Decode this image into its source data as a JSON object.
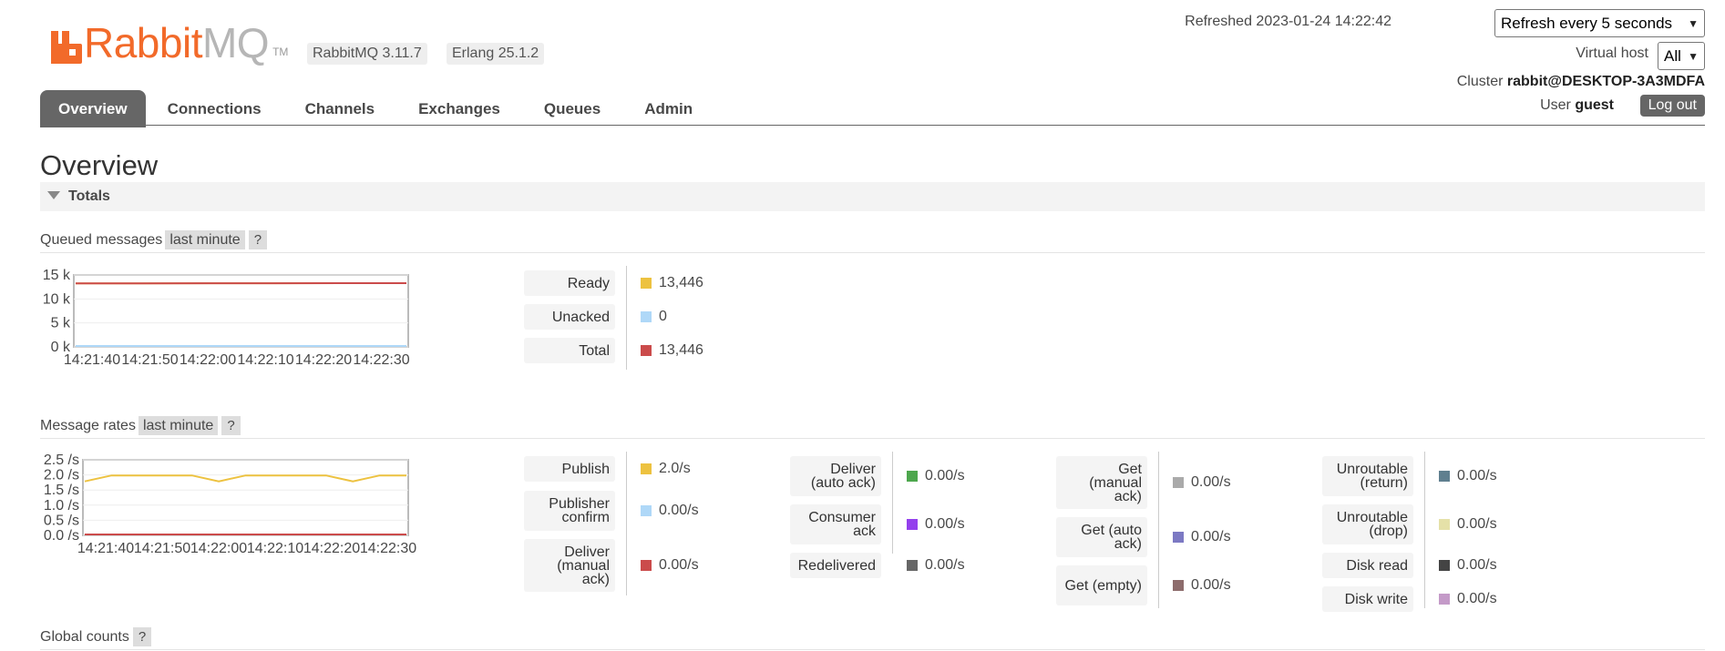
{
  "header": {
    "logo_text": "Rabbit",
    "logo_mq": "MQ",
    "logo_tm": "TM",
    "rabbitmq_version": "RabbitMQ 3.11.7",
    "erlang_version": "Erlang 25.1.2",
    "refreshed_label": "Refreshed 2023-01-24 14:22:42",
    "refresh_select": "Refresh every 5 seconds",
    "vhost_label": "Virtual host",
    "vhost_select": "All",
    "cluster_label": "Cluster",
    "cluster_name": "rabbit@DESKTOP-3A3MDFA",
    "user_label": "User",
    "user_name": "guest",
    "logout": "Log out",
    "logo_color": "#f26a2a"
  },
  "nav": {
    "tabs": [
      "Overview",
      "Connections",
      "Channels",
      "Exchanges",
      "Queues",
      "Admin"
    ],
    "active": "Overview"
  },
  "page": {
    "title": "Overview",
    "totals_section": "Totals",
    "queued_label": "Queued messages",
    "rates_label": "Message rates",
    "range_badge": "last minute",
    "help": "?",
    "global_counts": "Global counts"
  },
  "chart_data": [
    {
      "type": "line",
      "title": "Queued messages",
      "x": [
        "14:21:40",
        "14:21:50",
        "14:22:00",
        "14:22:10",
        "14:22:20",
        "14:22:30"
      ],
      "ytick_labels": [
        "15 k",
        "10 k",
        "5 k",
        "0 k"
      ],
      "ylim": [
        0,
        15000
      ],
      "series": [
        {
          "name": "Ready",
          "color": "#edc240",
          "values": [
            13380,
            13400,
            13420,
            13430,
            13440,
            13446
          ]
        },
        {
          "name": "Unacked",
          "color": "#afd8f8",
          "values": [
            0,
            0,
            0,
            0,
            0,
            0
          ]
        },
        {
          "name": "Total",
          "color": "#cb4b4b",
          "values": [
            13380,
            13400,
            13420,
            13430,
            13440,
            13446
          ]
        }
      ]
    },
    {
      "type": "line",
      "title": "Message rates",
      "x": [
        "14:21:40",
        "14:21:50",
        "14:22:00",
        "14:22:10",
        "14:22:20",
        "14:22:30"
      ],
      "ytick_labels": [
        "2.5 /s",
        "2.0 /s",
        "1.5 /s",
        "1.0 /s",
        "0.5 /s",
        "0.0 /s"
      ],
      "ylim": [
        0,
        2.5
      ],
      "series": [
        {
          "name": "Publish",
          "color": "#edc240",
          "values": [
            1.8,
            2.0,
            2.0,
            2.0,
            2.0,
            1.8,
            2.0,
            2.0,
            2.0,
            2.0,
            1.8,
            2.0,
            2.0
          ]
        },
        {
          "name": "Deliver (manual ack)",
          "color": "#cb4b4b",
          "values": [
            0,
            0,
            0,
            0,
            0,
            0,
            0,
            0,
            0,
            0,
            0,
            0,
            0
          ]
        }
      ]
    }
  ],
  "queued_legend": [
    {
      "label": "Ready",
      "value": "13,446",
      "color": "#edc240"
    },
    {
      "label": "Unacked",
      "value": "0",
      "color": "#afd8f8"
    },
    {
      "label": "Total",
      "value": "13,446",
      "color": "#cb4b4b"
    }
  ],
  "rates_legend": {
    "col1": [
      {
        "label": "Publish",
        "value": "2.0/s",
        "color": "#edc240"
      },
      {
        "label": "Publisher confirm",
        "value": "0.00/s",
        "color": "#afd8f8"
      },
      {
        "label": "Deliver (manual ack)",
        "value": "0.00/s",
        "color": "#cb4b4b"
      }
    ],
    "col2": [
      {
        "label": "Deliver (auto ack)",
        "value": "0.00/s",
        "color": "#4da74d"
      },
      {
        "label": "Consumer ack",
        "value": "0.00/s",
        "color": "#9440ed"
      },
      {
        "label": "Redelivered",
        "value": "0.00/s",
        "color": "#666666"
      }
    ],
    "col3": [
      {
        "label": "Get (manual ack)",
        "value": "0.00/s",
        "color": "#aaaaaa"
      },
      {
        "label": "Get (auto ack)",
        "value": "0.00/s",
        "color": "#7c79c3"
      },
      {
        "label": "Get (empty)",
        "value": "0.00/s",
        "color": "#8d6c6c"
      }
    ],
    "col4": [
      {
        "label": "Unroutable (return)",
        "value": "0.00/s",
        "color": "#5f7f8f"
      },
      {
        "label": "Unroutable (drop)",
        "value": "0.00/s",
        "color": "#e5e1a8"
      },
      {
        "label": "Disk read",
        "value": "0.00/s",
        "color": "#444444"
      },
      {
        "label": "Disk write",
        "value": "0.00/s",
        "color": "#c49ac8"
      }
    ]
  }
}
